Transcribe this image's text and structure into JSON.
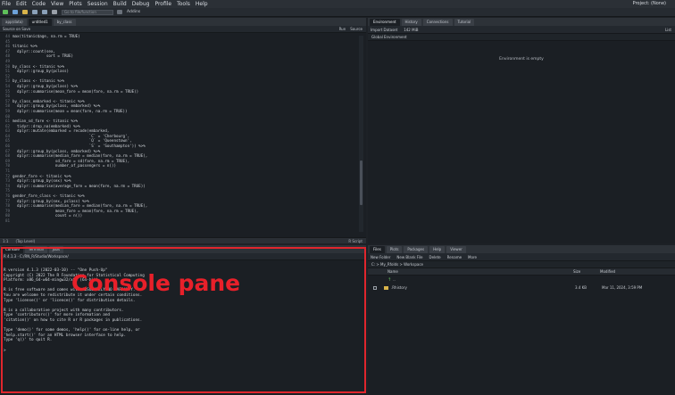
{
  "menubar": {
    "items": [
      "File",
      "Edit",
      "Code",
      "View",
      "Plots",
      "Session",
      "Build",
      "Debug",
      "Profile",
      "Tools",
      "Help"
    ],
    "project": "Project: (None)"
  },
  "toolbar": {
    "goto_placeholder": "Go to file/function",
    "addins": "Addins"
  },
  "source": {
    "tabs": [
      "app(data)",
      "untitled1",
      "by_class"
    ],
    "source_on_save": "Source on Save",
    "run": "Run",
    "source": "Source",
    "status_pos": "1:1",
    "status_scope": "(Top Level)",
    "status_lang": "R Script",
    "lines": [
      {
        "n": "44",
        "t": "max(titanic$age, na.rm = TRUE)"
      },
      {
        "n": "45",
        "t": ""
      },
      {
        "n": "46",
        "t": "titanic %>%"
      },
      {
        "n": "47",
        "t": "  dplyr::count(sex,"
      },
      {
        "n": "48",
        "t": "               sort = TRUE)"
      },
      {
        "n": "49",
        "t": ""
      },
      {
        "n": "50",
        "t": "by_class <- titanic %>%"
      },
      {
        "n": "51",
        "t": "  dplyr::group_by(pclass)"
      },
      {
        "n": "52",
        "t": ""
      },
      {
        "n": "53",
        "t": "by_class <- titanic %>%"
      },
      {
        "n": "54",
        "t": "  dplyr::group_by(pclass) %>%"
      },
      {
        "n": "55",
        "t": "  dplyr::summarise(mean_fare = mean(fare, na.rm = TRUE))"
      },
      {
        "n": "56",
        "t": ""
      },
      {
        "n": "57",
        "t": "by_class_embarked <- titanic %>%"
      },
      {
        "n": "58",
        "t": "  dplyr::group_by(pclass, embarked) %>%"
      },
      {
        "n": "59",
        "t": "  dplyr::summarise(mean = mean(fare, na.rm = TRUE))"
      },
      {
        "n": "60",
        "t": ""
      },
      {
        "n": "61",
        "t": "median_sd_fare <- titanic %>%"
      },
      {
        "n": "62",
        "t": "  tidyr::drop_na(embarked) %>%"
      },
      {
        "n": "63",
        "t": "  dplyr::mutate(embarked = recode(embarked,"
      },
      {
        "n": "64",
        "t": "                                  `C` = 'Cherbourg',"
      },
      {
        "n": "65",
        "t": "                                  `Q` = 'Queenstown',"
      },
      {
        "n": "66",
        "t": "                                  `S` = 'Southampton')) %>%"
      },
      {
        "n": "67",
        "t": "  dplyr::group_by(pclass, embarked) %>%"
      },
      {
        "n": "68",
        "t": "  dplyr::summarise(median_fare = median(fare, na.rm = TRUE),"
      },
      {
        "n": "69",
        "t": "                   sd_fare = sd(fare, na.rm = TRUE),"
      },
      {
        "n": "70",
        "t": "                   number_of_passengers = n())"
      },
      {
        "n": "71",
        "t": ""
      },
      {
        "n": "72",
        "t": "gender_fare <- titanic %>%"
      },
      {
        "n": "73",
        "t": "  dplyr::group_by(sex) %>%"
      },
      {
        "n": "74",
        "t": "  dplyr::summarise(average_fare = mean(fare, na.rm = TRUE))"
      },
      {
        "n": "75",
        "t": ""
      },
      {
        "n": "76",
        "t": "gender_fare_class <- titanic %>%"
      },
      {
        "n": "77",
        "t": "  dplyr::group_by(sex, pclass) %>%"
      },
      {
        "n": "78",
        "t": "  dplyr::summarise(median_fare = median(fare, na.rm = TRUE),"
      },
      {
        "n": "79",
        "t": "                   mean_fare = mean(fare, na.rm = TRUE),"
      },
      {
        "n": "80",
        "t": "                   count = n())"
      },
      {
        "n": "81",
        "t": ""
      }
    ]
  },
  "console": {
    "tabs": [
      "Console",
      "Terminal",
      "Jobs"
    ],
    "path": "R 4.1.3 · C:/RN_R/Studio/Workspace/",
    "text": "R version 4.1.3 (2022-03-10) -- \"One Push-Up\"\nCopyright (C) 2022 The R Foundation for Statistical Computing\nPlatform: x86_64-w64-mingw32/x64 (64-bit)\n\nR is free software and comes with ABSOLUTELY NO WARRANTY.\nYou are welcome to redistribute it under certain conditions.\nType 'license()' or 'licence()' for distribution details.\n\nR is a collaborative project with many contributors.\nType 'contributors()' for more information and\n'citation()' on how to cite R or R packages in publications.\n\nType 'demo()' for some demos, 'help()' for on-line help, or\n'help.start()' for an HTML browser interface to help.\nType 'q()' to quit R.\n\n>",
    "annotation": "Console pane"
  },
  "environment": {
    "tabs": [
      "Environment",
      "History",
      "Connections",
      "Tutorial"
    ],
    "import_dataset": "Import Dataset",
    "memory": "142 MiB",
    "view": "List",
    "scope": "Global Environment",
    "empty_msg": "Environment is empty"
  },
  "files": {
    "tabs": [
      "Files",
      "Plots",
      "Packages",
      "Help",
      "Viewer"
    ],
    "new_folder": "New Folder",
    "new_blank_file": "New Blank File",
    "delete": "Delete",
    "rename": "Rename",
    "more": "More",
    "path": "C: > My_Rfolds > Workspace",
    "col_name": "Name",
    "col_size": "Size",
    "col_modified": "Modified",
    "up": "..",
    "rows": [
      {
        "name": ".Rhistory",
        "size": "3.4 KB",
        "modified": "Mar 11, 2024, 3:59 PM"
      }
    ]
  },
  "colors": {
    "highlight": "#e0262d",
    "background": "#1b1f24"
  }
}
